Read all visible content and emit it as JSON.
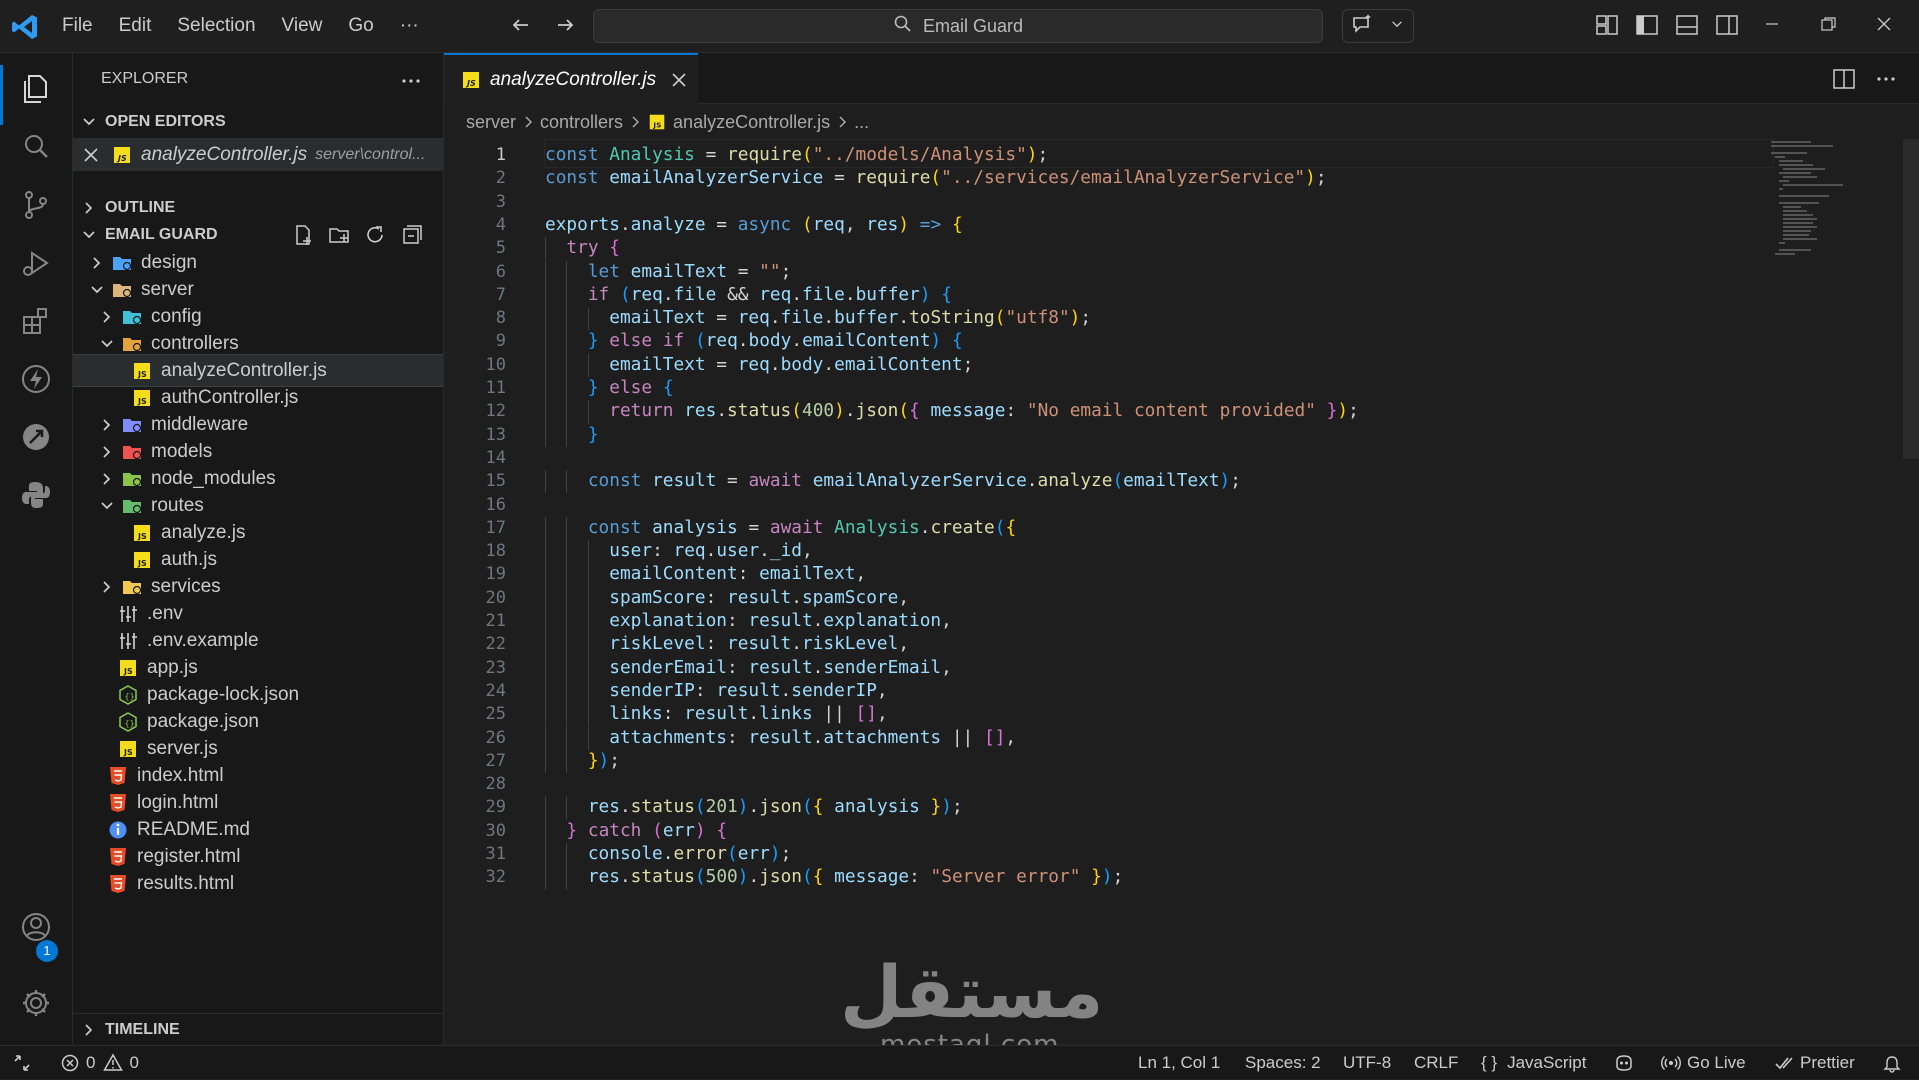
{
  "menu": [
    "File",
    "Edit",
    "Selection",
    "View",
    "Go",
    "···"
  ],
  "search": {
    "label": "Email Guard"
  },
  "explorer": {
    "title": "EXPLORER",
    "open_editors": {
      "title": "OPEN EDITORS",
      "items": [
        {
          "name": "analyzeController.js",
          "path": "server\\control..."
        }
      ]
    },
    "outline": "OUTLINE",
    "project": "EMAIL GUARD",
    "tree": [
      {
        "label": "design",
        "type": "folder",
        "icon": "folder-design-icon"
      },
      {
        "label": "server",
        "type": "folder",
        "icon": "folder-server-icon"
      },
      {
        "label": "config",
        "type": "folder",
        "icon": "folder-config-icon"
      },
      {
        "label": "controllers",
        "type": "folder",
        "icon": "folder-controllers-icon"
      },
      {
        "label": "analyzeController.js",
        "type": "file",
        "icon": "js-file-icon"
      },
      {
        "label": "authController.js",
        "type": "file",
        "icon": "js-file-icon"
      },
      {
        "label": "middleware",
        "type": "folder",
        "icon": "folder-middleware-icon"
      },
      {
        "label": "models",
        "type": "folder",
        "icon": "folder-models-icon"
      },
      {
        "label": "node_modules",
        "type": "folder",
        "icon": "folder-node-icon"
      },
      {
        "label": "routes",
        "type": "folder",
        "icon": "folder-routes-icon"
      },
      {
        "label": "analyze.js",
        "type": "file",
        "icon": "js-file-icon"
      },
      {
        "label": "auth.js",
        "type": "file",
        "icon": "js-file-icon"
      },
      {
        "label": "services",
        "type": "folder",
        "icon": "folder-services-icon"
      },
      {
        "label": ".env",
        "type": "file",
        "icon": "env-file-icon"
      },
      {
        "label": ".env.example",
        "type": "file",
        "icon": "env-file-icon"
      },
      {
        "label": "app.js",
        "type": "file",
        "icon": "js-file-icon"
      },
      {
        "label": "package-lock.json",
        "type": "file",
        "icon": "node-json-icon"
      },
      {
        "label": "package.json",
        "type": "file",
        "icon": "node-json-icon"
      },
      {
        "label": "server.js",
        "type": "file",
        "icon": "js-file-icon"
      },
      {
        "label": "index.html",
        "type": "file",
        "icon": "html-file-icon"
      },
      {
        "label": "login.html",
        "type": "file",
        "icon": "html-file-icon"
      },
      {
        "label": "README.md",
        "type": "file",
        "icon": "info-file-icon"
      },
      {
        "label": "register.html",
        "type": "file",
        "icon": "html-file-icon"
      },
      {
        "label": "results.html",
        "type": "file",
        "icon": "html-file-icon"
      }
    ],
    "timeline": "TIMELINE"
  },
  "tab": {
    "label": "analyzeController.js"
  },
  "breadcrumb": [
    "server",
    "controllers",
    "analyzeController.js",
    "..."
  ],
  "code": {
    "language": "JavaScript",
    "lines": [
      "const Analysis = require(\"../models/Analysis\");",
      "const emailAnalyzerService = require(\"../services/emailAnalyzerService\");",
      "",
      "exports.analyze = async (req, res) => {",
      "  try {",
      "    let emailText = \"\";",
      "    if (req.file && req.file.buffer) {",
      "      emailText = req.file.buffer.toString(\"utf8\");",
      "    } else if (req.body.emailContent) {",
      "      emailText = req.body.emailContent;",
      "    } else {",
      "      return res.status(400).json({ message: \"No email content provided\" });",
      "    }",
      "",
      "    const result = await emailAnalyzerService.analyze(emailText);",
      "",
      "    const analysis = await Analysis.create({",
      "      user: req.user._id,",
      "      emailContent: emailText,",
      "      spamScore: result.spamScore,",
      "      explanation: result.explanation,",
      "      riskLevel: result.riskLevel,",
      "      senderEmail: result.senderEmail,",
      "      senderIP: result.senderIP,",
      "      links: result.links || [],",
      "      attachments: result.attachments || [],",
      "    });",
      "",
      "    res.status(201).json({ analysis });",
      "  } catch (err) {",
      "    console.error(err);",
      "    res.status(500).json({ message: \"Server error\" });"
    ]
  },
  "watermark": {
    "main": "مستقل",
    "sub": "mostaql.com"
  },
  "status": {
    "errors": "0",
    "warnings": "0",
    "position": "Ln 1, Col 1",
    "spaces": "Spaces: 2",
    "encoding": "UTF-8",
    "eol": "CRLF",
    "language": "JavaScript",
    "golive": "Go Live",
    "prettier": "Prettier"
  },
  "notifications": {
    "accounts_badge": "1"
  },
  "colors": {
    "accent": "#0078d4",
    "background": "#1e1e1e",
    "sidebar": "#181818",
    "js_icon": "#f5de19",
    "html_icon": "#e44d26"
  }
}
